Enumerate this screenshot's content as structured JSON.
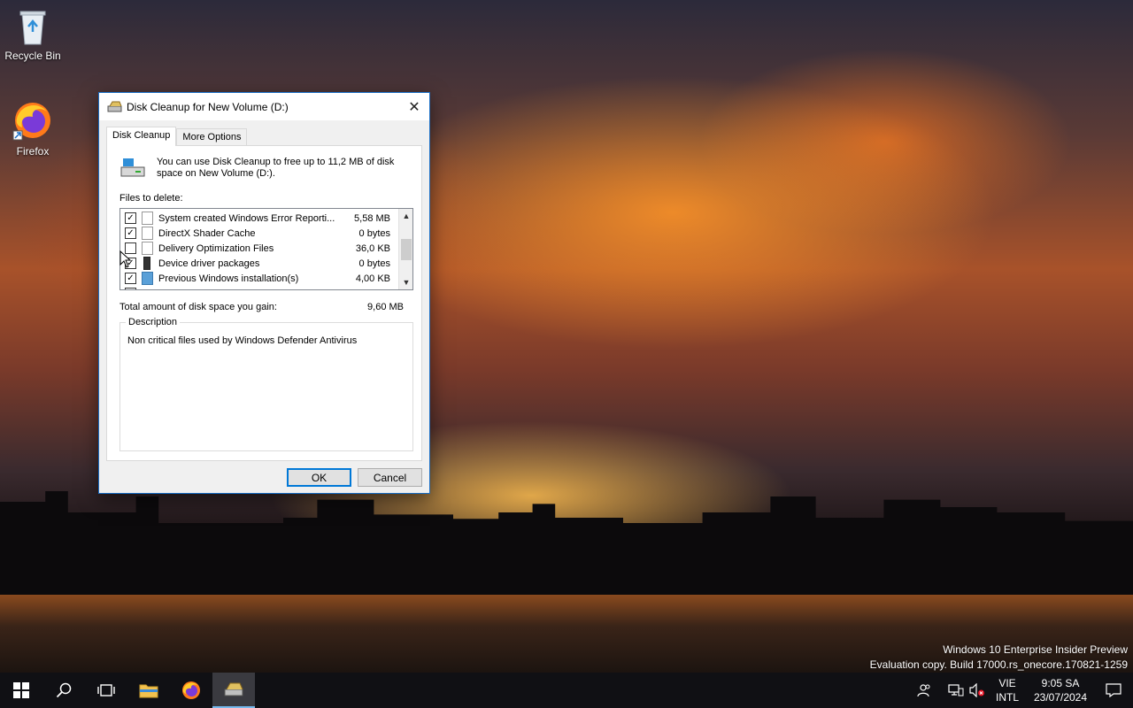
{
  "desktop": {
    "icons": [
      {
        "label": "Recycle Bin",
        "icon": "recycle-bin-icon"
      },
      {
        "label": "Firefox",
        "icon": "firefox-icon"
      }
    ],
    "watermark": {
      "line1": "Windows 10 Enterprise Insider Preview",
      "line2": "Evaluation copy. Build 17000.rs_onecore.170821-1259"
    }
  },
  "dialog": {
    "title": "Disk Cleanup for New Volume (D:)",
    "tabs": [
      {
        "label": "Disk Cleanup",
        "active": true
      },
      {
        "label": "More Options",
        "active": false
      }
    ],
    "intro_text": "You can use Disk Cleanup to free up to 11,2 MB of disk space on New Volume (D:).",
    "files_label": "Files to delete:",
    "files": [
      {
        "name": "System created Windows Error Reporti...",
        "size": "5,58 MB",
        "checked": true,
        "icon": "file-icon"
      },
      {
        "name": "DirectX Shader Cache",
        "size": "0 bytes",
        "checked": true,
        "icon": "file-icon"
      },
      {
        "name": "Delivery Optimization Files",
        "size": "36,0 KB",
        "checked": false,
        "icon": "file-icon"
      },
      {
        "name": "Device driver packages",
        "size": "0 bytes",
        "checked": true,
        "icon": "driver-icon"
      },
      {
        "name": "Previous Windows installation(s)",
        "size": "4,00 KB",
        "checked": true,
        "icon": "windows-icon"
      }
    ],
    "total_label": "Total amount of disk space you gain:",
    "total_value": "9,60 MB",
    "description_title": "Description",
    "description_text": "Non critical files used by Windows Defender Antivirus",
    "ok_label": "OK",
    "cancel_label": "Cancel",
    "close_symbol": "✕"
  },
  "taskbar": {
    "language": {
      "line1": "VIE",
      "line2": "INTL"
    },
    "clock": {
      "time": "9:05 SA",
      "date": "23/07/2024"
    },
    "accent_color": "#76b9ed"
  }
}
